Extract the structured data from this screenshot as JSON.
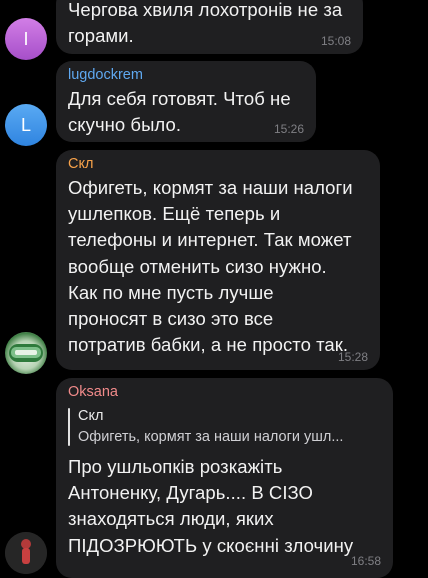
{
  "messages": [
    {
      "avatar_letter": "I",
      "text": "Чергова хвиля лохотронів не за\nгорами.",
      "time": "15:08"
    },
    {
      "sender": "lugdockrem",
      "avatar_letter": "L",
      "text": "Для себя готовят. Чтоб не\nскучно было.",
      "time": "15:26"
    },
    {
      "sender": "Скл",
      "text": "Офигеть, кормят за наши налоги\nушлепков. Ещё теперь и\nтелефоны и интернет. Так может\nвообще отменить сизо нужно.\nКак по мне пусть лучше\nпроносят в сизо это все\nпотратив бабки, а не просто так.",
      "time": "15:28"
    },
    {
      "sender": "Oksana",
      "reply_to": {
        "sender": "Скл",
        "text": "Офигеть, кормят за наши налоги ушл..."
      },
      "text": "Про ушльопків розкажіть\nАнтоненку, Дугарь.... В СІЗО\nзнаходяться люди, яких\nПІДОЗРЮЮТЬ у скоєнні злочину",
      "time": "16:58"
    }
  ],
  "colors": {
    "background": "#000000",
    "bubble": "#1f1f21",
    "text": "#f2f2f2",
    "time": "#7f7f84",
    "sender_lugdockrem": "#5fa8f0",
    "sender_skl": "#f7a24a",
    "sender_oksana": "#f08a8a",
    "avatar_i": "#c06ad8",
    "avatar_l": "#3d95ec"
  }
}
